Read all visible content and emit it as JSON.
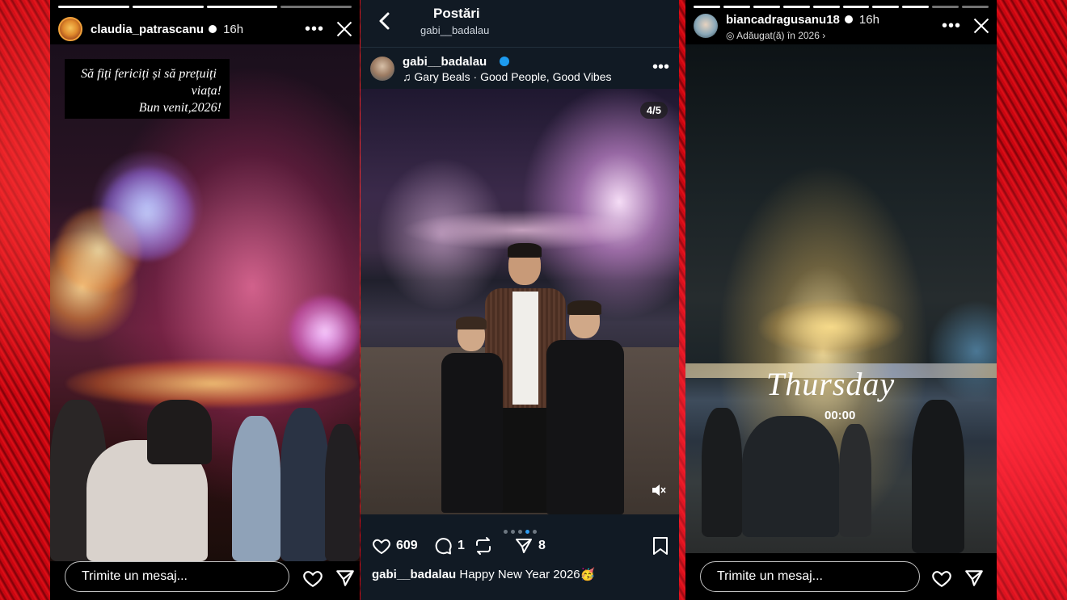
{
  "colors": {
    "background_red": "#d80a14",
    "instagram_blue": "#1d9bf0",
    "panel_dark": "#111a24"
  },
  "left_story": {
    "username": "claudia_patrascanu",
    "time": "16h",
    "more_icon": "more-horizontal-icon",
    "close_icon": "close-icon",
    "caption_lines": [
      "Să fiți fericiți și să prețuiți",
      "viața!",
      "Bun venit,2026!"
    ],
    "reply_placeholder": "Trimite un mesaj...",
    "like_icon": "heart-icon",
    "share_icon": "send-icon"
  },
  "center_post": {
    "header_title": "Postări",
    "header_subtitle": "gabi__badalau",
    "back_icon": "chevron-left-icon",
    "author": "gabi__badalau",
    "music": "Gary Beals · Good People, Good Vibes",
    "counter": "4/5",
    "carousel_active": 4,
    "carousel_total": 5,
    "likes": "609",
    "comments": "1",
    "shares": "8",
    "caption_user": "gabi__badalau",
    "caption_text": "Happy New Year 2026🥳"
  },
  "right_story": {
    "username": "biancadragusanu18",
    "time": "16h",
    "added_label": "Adăugat(ă) în 2026",
    "sticker_day": "Thursday",
    "sticker_time": "00:00",
    "reply_placeholder": "Trimite un mesaj..."
  }
}
